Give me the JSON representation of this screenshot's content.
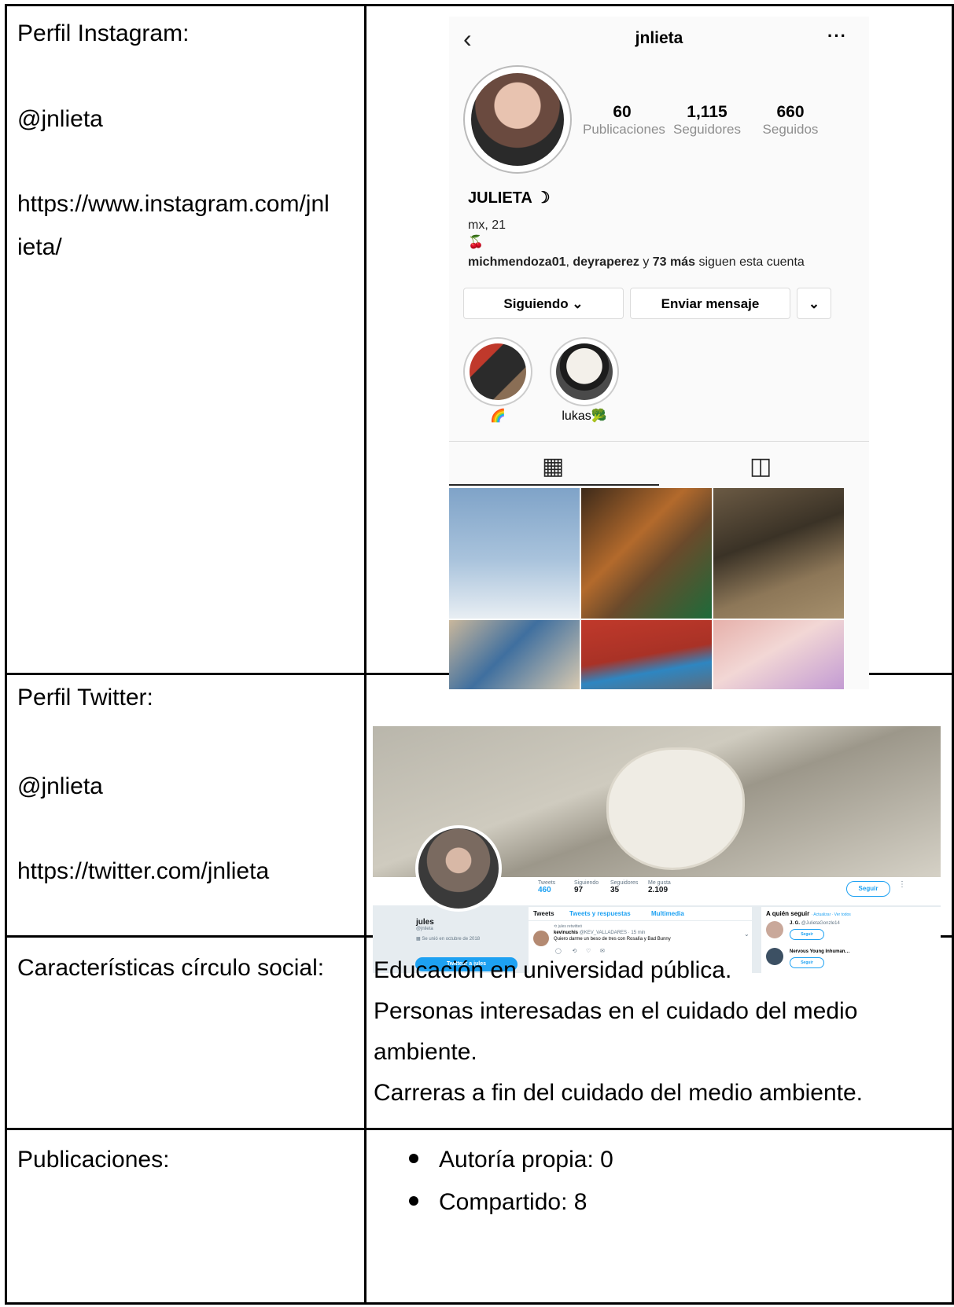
{
  "table": {
    "row1": {
      "label": "Perfil Instagram:",
      "handle": "@jnlieta",
      "url_line1": "https://www.instagram.com/jnl",
      "url_line2": "ieta/"
    },
    "row2": {
      "label": "Perfil Twitter:",
      "handle": "@jnlieta",
      "url": "https://twitter.com/jnlieta"
    },
    "row3": {
      "label": "Características círculo social:",
      "lines": [
        "Educación en universidad pública.",
        "Personas interesadas en el cuidado del medio",
        "ambiente.",
        "Carreras a fin del cuidado del medio ambiente."
      ]
    },
    "row4": {
      "label": "Publicaciones:",
      "bullets": [
        "Autoría propia: 0",
        "Compartido: 8"
      ]
    }
  },
  "instagram": {
    "username": "jnlieta",
    "back_icon": "‹",
    "more_icon": "···",
    "stats": [
      {
        "value": "60",
        "label": "Publicaciones"
      },
      {
        "value": "1,115",
        "label": "Seguidores"
      },
      {
        "value": "660",
        "label": "Seguidos"
      }
    ],
    "display_name": "JULIETA ☽",
    "bio_line1": "mx, 21",
    "bio_line2": "🍒",
    "followed_by_a": "michmendoza01",
    "followed_by_sep1": ", ",
    "followed_by_b": "deyraperez",
    "followed_by_sep2": " y ",
    "followed_by_c": "73 más",
    "followed_by_tail": " siguen esta cuenta",
    "btn_following": "Siguiendo ⌄",
    "btn_message": "Enviar mensaje",
    "btn_more": "⌄",
    "highlights": [
      "🌈",
      "lukas🥦"
    ]
  },
  "twitter": {
    "stats": [
      {
        "label": "Tweets",
        "value": "460"
      },
      {
        "label": "Siguiendo",
        "value": "97"
      },
      {
        "label": "Seguidores",
        "value": "35"
      },
      {
        "label": "Me gusta",
        "value": "2.109"
      }
    ],
    "follow_button": "Seguir",
    "name": "jules",
    "handle": "@jnlieta",
    "joined": "Se unió en octubre de 2018",
    "tweet_button": "Twittear a jules",
    "tabs": [
      "Tweets",
      "Tweets y respuestas",
      "Multimedia"
    ],
    "retweet_note": "jules retwitteó",
    "tweet_author": "kevinuchis",
    "tweet_meta": "@KEV_VALLADARES · 15 min",
    "tweet_text": "Quiero darme un beso de tres con Rosalía y Bad Bunny",
    "who_to_follow": "A quién seguir",
    "who_to_follow_links": "· Actualizar · Ver todos",
    "suggestions": [
      {
        "name": "J. G.",
        "handle": "@JulietaGonzle14",
        "button": "Seguir"
      },
      {
        "name": "Nervous Young Inhuman…",
        "handle": "",
        "button": "Seguir"
      }
    ]
  }
}
